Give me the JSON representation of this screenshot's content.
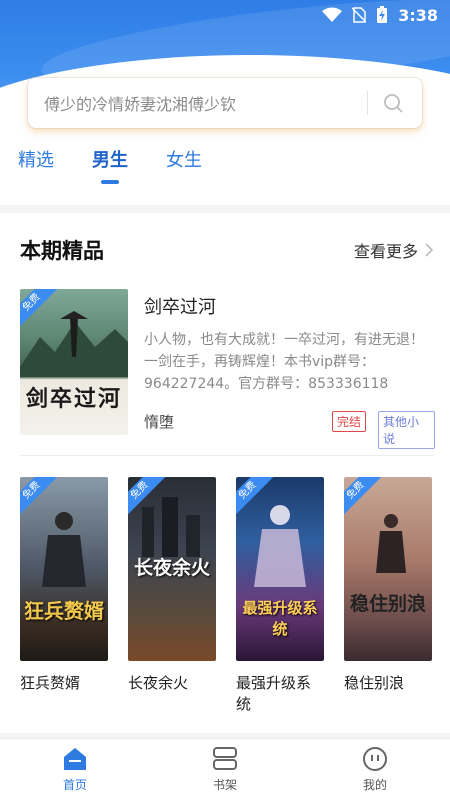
{
  "status_bar": {
    "time": "3:38"
  },
  "search": {
    "placeholder": "傅少的冷情娇妻沈湘傅少钦"
  },
  "tabs": [
    {
      "label": "精选",
      "active": false
    },
    {
      "label": "男生",
      "active": true
    },
    {
      "label": "女生",
      "active": false
    }
  ],
  "section": {
    "title": "本期精品",
    "more_label": "查看更多"
  },
  "featured": {
    "badge": "免费",
    "cover_title": "剑卒过河",
    "title": "剑卒过河",
    "description": "小人物，也有大成就！一卒过河，有进无退！一剑在手，再铸辉煌！本书vip群号：964227244。官方群号：853336118",
    "author": "惰堕",
    "tags": [
      "完结",
      "其他小说"
    ]
  },
  "books": [
    {
      "title": "狂兵赘婿",
      "badge": "免费",
      "cover_text": "狂兵赘婿"
    },
    {
      "title": "长夜余火",
      "badge": "免费",
      "cover_text": "长夜余火"
    },
    {
      "title": "最强升级系统",
      "badge": "免费",
      "cover_text": "最强升级系统"
    },
    {
      "title": "稳住别浪",
      "badge": "免费",
      "cover_text": "稳住别浪"
    }
  ],
  "bottom_nav": [
    {
      "label": "首页",
      "icon": "home-icon",
      "active": true
    },
    {
      "label": "书架",
      "icon": "bookshelf-icon",
      "active": false
    },
    {
      "label": "我的",
      "icon": "profile-icon",
      "active": false
    }
  ],
  "colors": {
    "accent": "#2d7ae0",
    "hero": "#3d8ef0",
    "tag_done": "#e04848",
    "tag_other": "#6e7fd8"
  }
}
